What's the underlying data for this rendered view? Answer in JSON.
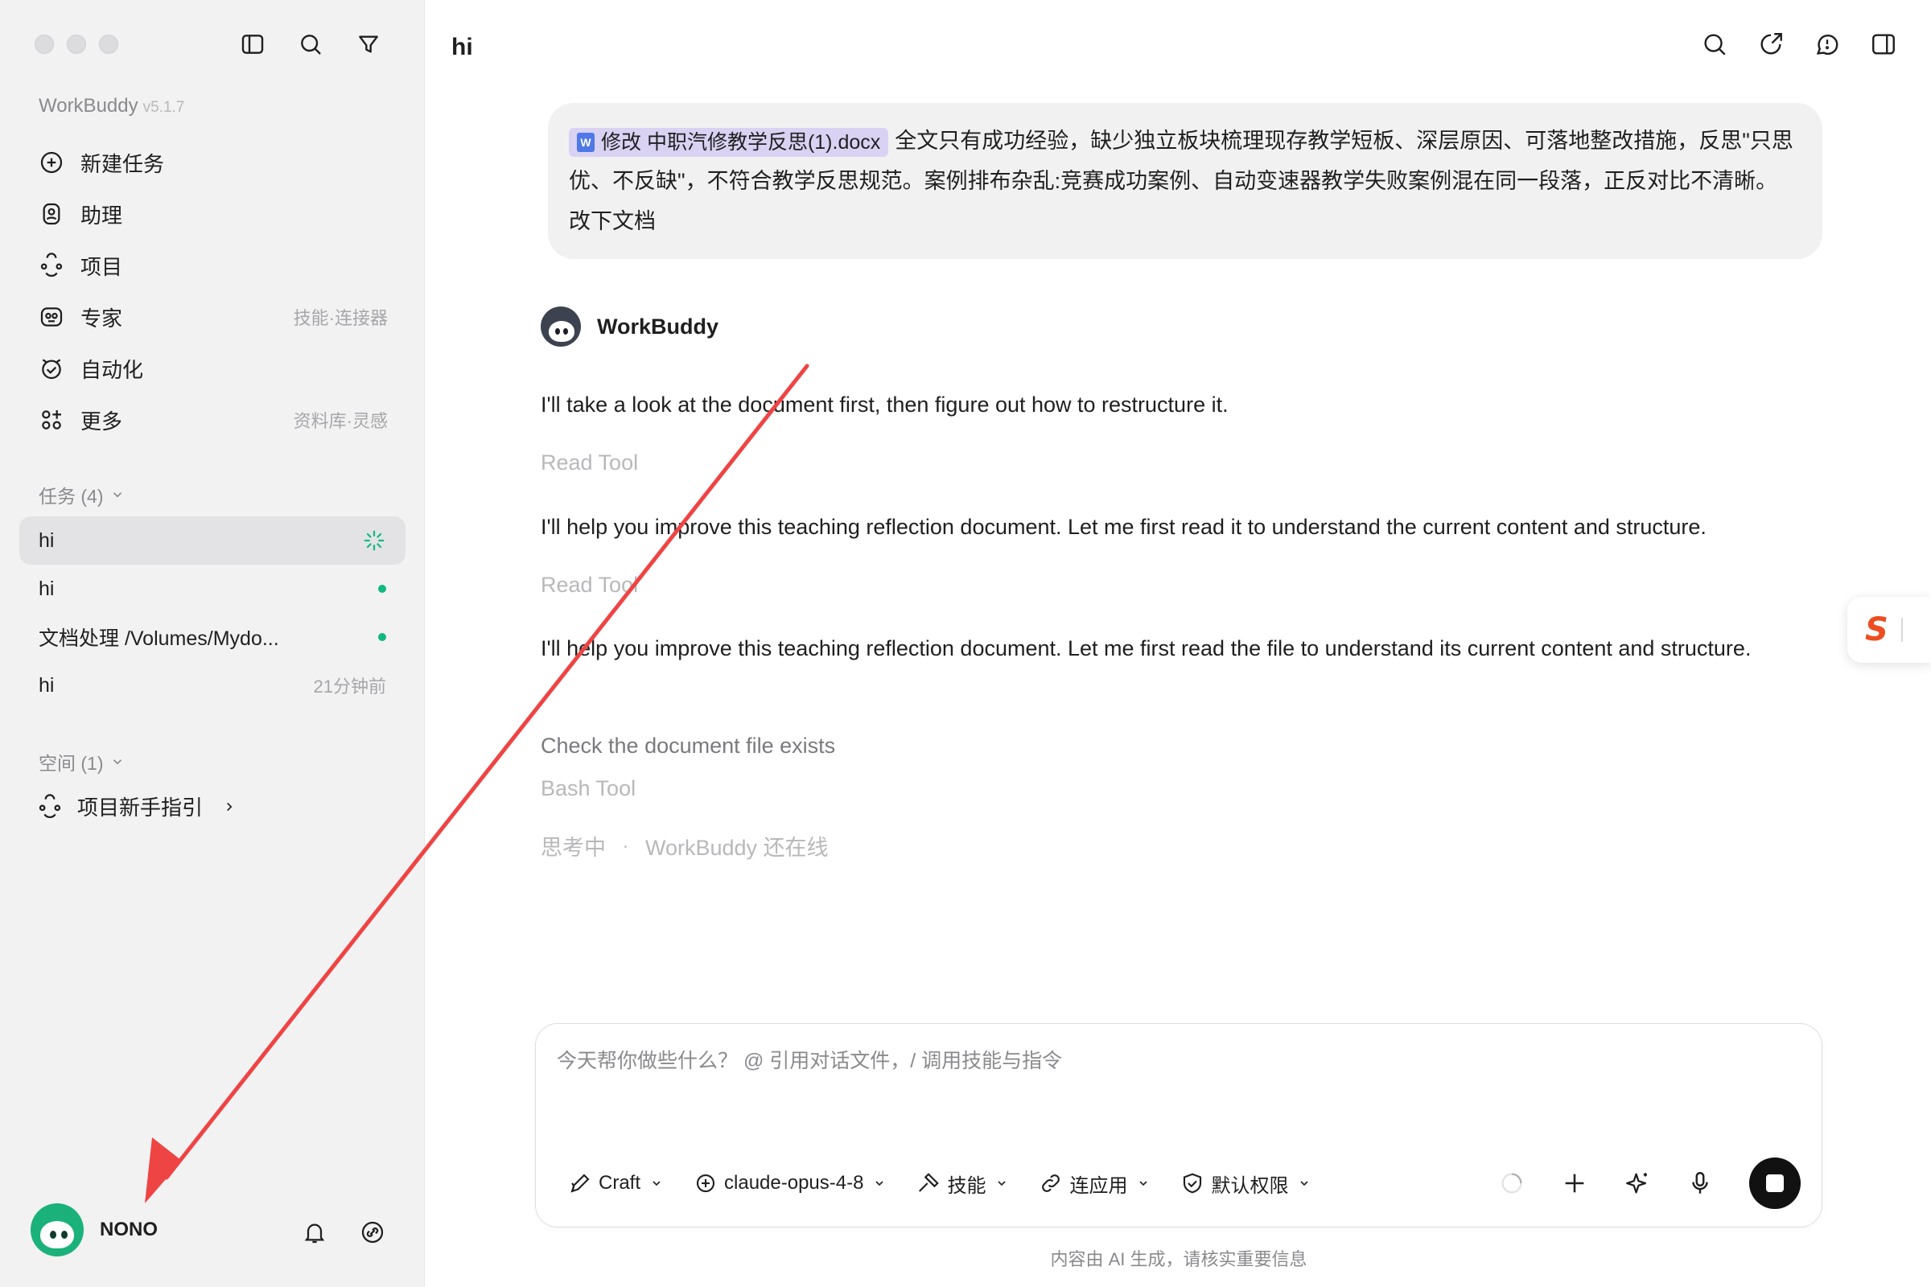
{
  "sidebar": {
    "brand": "WorkBuddy",
    "version": "v5.1.7",
    "nav": [
      {
        "label": "新建任务",
        "hint": ""
      },
      {
        "label": "助理",
        "hint": ""
      },
      {
        "label": "项目",
        "hint": ""
      },
      {
        "label": "专家",
        "hint": "技能·连接器"
      },
      {
        "label": "自动化",
        "hint": ""
      },
      {
        "label": "更多",
        "hint": "资料库·灵感"
      }
    ],
    "tasks_header": "任务 (4)",
    "tasks": [
      {
        "label": "hi",
        "meta": "",
        "status": "running"
      },
      {
        "label": "hi",
        "meta": "",
        "status": "done"
      },
      {
        "label": "文档处理 /Volumes/Mydo...",
        "meta": "",
        "status": "done"
      },
      {
        "label": "hi",
        "meta": "21分钟前",
        "status": "idle"
      }
    ],
    "spaces_header": "空间 (1)",
    "spaces": [
      {
        "label": "项目新手指引"
      }
    ],
    "user": {
      "name": "NONO"
    }
  },
  "main": {
    "title": "hi",
    "user_message": {
      "attachment": "修改 中职汽修教学反思(1).docx",
      "text": "全文只有成功经验，缺少独立板块梳理现存教学短板、深层原因、可落地整改措施，反思\"只思优、不反缺\"，不符合教学反思规范。案例排布杂乱:竞赛成功案例、自动变速器教学失败案例混在同一段落，正反对比不清晰。 改下文档"
    },
    "assistant": {
      "name": "WorkBuddy",
      "msg1": "I'll take a look at the document first, then figure out how to restructure it.",
      "tool1": "Read Tool",
      "msg2": "I'll help you improve this teaching reflection document. Let me first read it to understand the current content and structure.",
      "tool2": "Read Tool",
      "msg3": "I'll help you improve this teaching reflection document. Let me first read the file to understand its current content and structure.",
      "step": "Check the document file exists",
      "tool3": "Bash Tool",
      "thinking": "思考中",
      "online": "WorkBuddy 还在线"
    },
    "composer": {
      "placeholder": "今天帮你做些什么？ @ 引用对话文件，/ 调用技能与指令",
      "mode": "Craft",
      "model": "claude-opus-4-8",
      "skills": "技能",
      "apps": "连应用",
      "permission": "默认权限"
    },
    "footer": "内容由 AI 生成，请核实重要信息"
  },
  "colors": {
    "accent_green": "#10b981",
    "chip_purple": "#d9d2f3",
    "annotation_red": "#ef4444"
  }
}
